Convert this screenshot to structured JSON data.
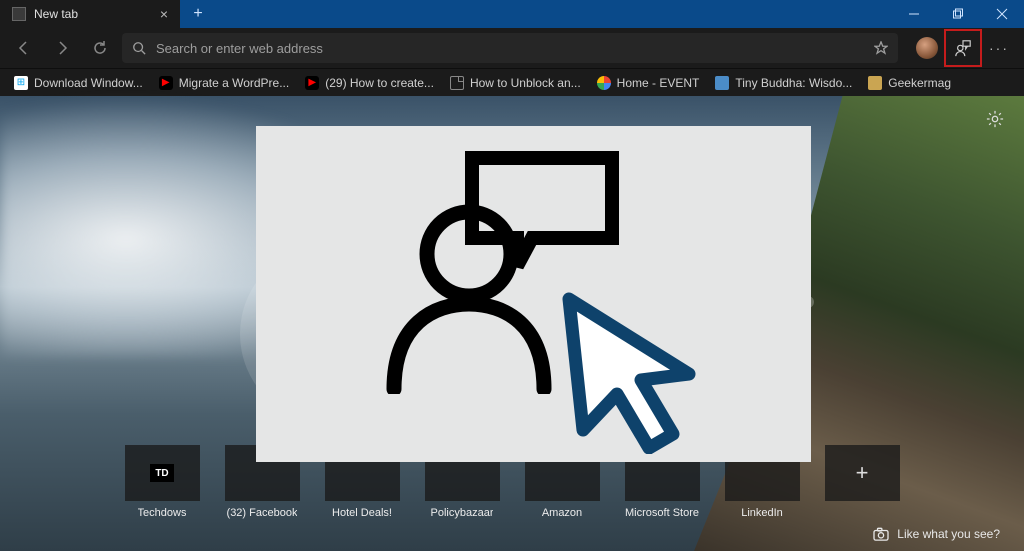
{
  "tab": {
    "title": "New tab"
  },
  "toolbar": {
    "search_placeholder": "Search or enter web address"
  },
  "bookmarks": [
    {
      "label": "Download Window...",
      "icon": "ms"
    },
    {
      "label": "Migrate a WordPre...",
      "icon": "yt"
    },
    {
      "label": "(29) How to create...",
      "icon": "yt"
    },
    {
      "label": "How to Unblock an...",
      "icon": "page"
    },
    {
      "label": "Home - EVENT",
      "icon": "g"
    },
    {
      "label": "Tiny Buddha: Wisdo...",
      "icon": "blue"
    },
    {
      "label": "Geekermag",
      "icon": "folder"
    }
  ],
  "tiles": [
    {
      "label": "Techdows",
      "icon": "td"
    },
    {
      "label": "(32) Facebook"
    },
    {
      "label": "Hotel Deals!"
    },
    {
      "label": "Policybazaar"
    },
    {
      "label": "Amazon"
    },
    {
      "label": "Microsoft Store"
    },
    {
      "label": "LinkedIn"
    }
  ],
  "footer": {
    "like_text": "Like what you see?"
  }
}
